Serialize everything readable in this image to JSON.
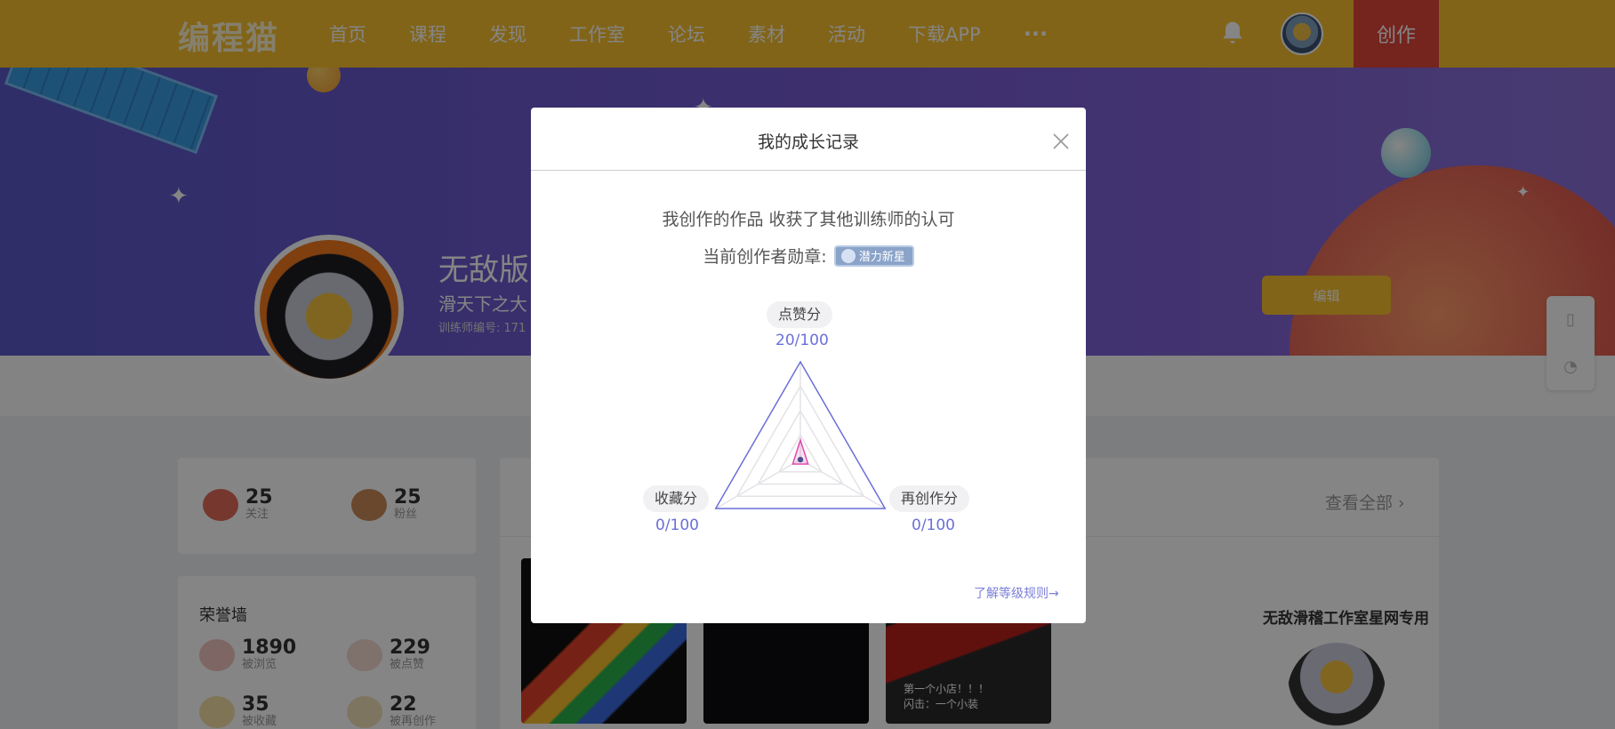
{
  "nav": {
    "logo": "编程猫",
    "links": [
      "首页",
      "课程",
      "发现",
      "工作室",
      "论坛",
      "素材",
      "活动",
      "下载APP"
    ],
    "more": "···",
    "create": "创作"
  },
  "banner": {
    "name": "无敌版",
    "subtitle": "滑天下之大",
    "id_label": "训练师编号: 171",
    "edit": "编辑"
  },
  "follow": {
    "following": {
      "count": "25",
      "label": "关注"
    },
    "fans": {
      "count": "25",
      "label": "粉丝"
    }
  },
  "honor": {
    "title": "荣誉墙",
    "items": [
      {
        "count": "1890",
        "label": "被浏览"
      },
      {
        "count": "229",
        "label": "被点赞"
      },
      {
        "count": "35",
        "label": "被收藏"
      },
      {
        "count": "22",
        "label": "被再创作"
      }
    ]
  },
  "works": {
    "view_all": "查看全部",
    "thumb3_text": "第一个小店！！！\n闪击：一个小装"
  },
  "studio": {
    "title": "无敌滑稽工作室星网专用"
  },
  "modal": {
    "title": "我的成长记录",
    "line1": "我创作的作品 收获了其他训练师的认可",
    "badge_label": "当前创作者勋章:",
    "badge_name": "潜力新星",
    "rules_link": "了解等级规则→"
  },
  "chart_data": {
    "type": "radar",
    "max": 100,
    "axes": [
      {
        "label": "点赞分",
        "value": 20,
        "display": "20/100"
      },
      {
        "label": "再创作分",
        "value": 0,
        "display": "0/100"
      },
      {
        "label": "收藏分",
        "value": 0,
        "display": "0/100"
      }
    ],
    "colors": {
      "outline": "#6b6fd8",
      "grid": "#e3e3e8",
      "data": "#e04ab0"
    }
  }
}
